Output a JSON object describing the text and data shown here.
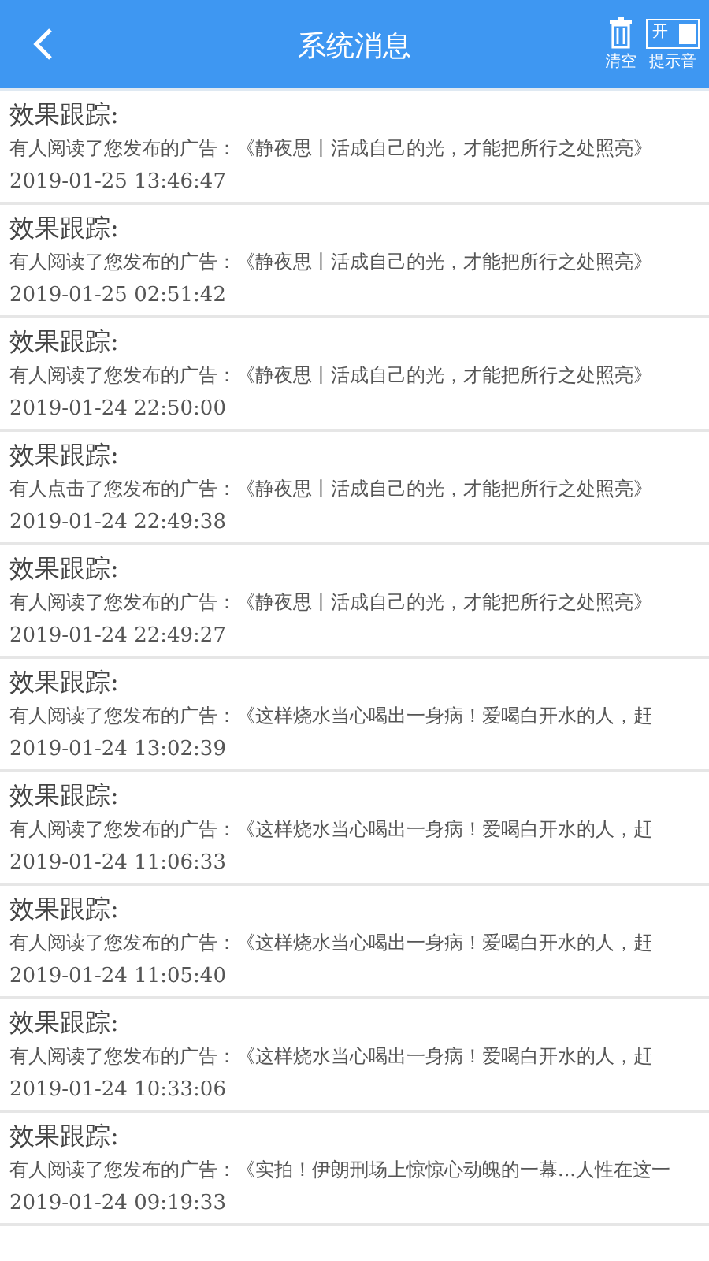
{
  "header": {
    "title": "系统消息",
    "clear_label": "清空",
    "sound_toggle": {
      "label": "开",
      "on": true
    },
    "sound_label": "提示音"
  },
  "messages": [
    {
      "title": "效果跟踪:",
      "text": "有人阅读了您发布的广告：《静夜思丨活成自己的光，才能把所行之处照亮》",
      "time": "2019-01-25 13:46:47"
    },
    {
      "title": "效果跟踪:",
      "text": "有人阅读了您发布的广告：《静夜思丨活成自己的光，才能把所行之处照亮》",
      "time": "2019-01-25 02:51:42"
    },
    {
      "title": "效果跟踪:",
      "text": "有人阅读了您发布的广告：《静夜思丨活成自己的光，才能把所行之处照亮》",
      "time": "2019-01-24 22:50:00"
    },
    {
      "title": "效果跟踪:",
      "text": "有人点击了您发布的广告：《静夜思丨活成自己的光，才能把所行之处照亮》",
      "time": "2019-01-24 22:49:38"
    },
    {
      "title": "效果跟踪:",
      "text": "有人阅读了您发布的广告：《静夜思丨活成自己的光，才能把所行之处照亮》",
      "time": "2019-01-24 22:49:27"
    },
    {
      "title": "效果跟踪:",
      "text": "有人阅读了您发布的广告：《这样烧水当心喝出一身病！爱喝白开水的人，赶",
      "time": "2019-01-24 13:02:39"
    },
    {
      "title": "效果跟踪:",
      "text": "有人阅读了您发布的广告：《这样烧水当心喝出一身病！爱喝白开水的人，赶",
      "time": "2019-01-24 11:06:33"
    },
    {
      "title": "效果跟踪:",
      "text": "有人阅读了您发布的广告：《这样烧水当心喝出一身病！爱喝白开水的人，赶",
      "time": "2019-01-24 11:05:40"
    },
    {
      "title": "效果跟踪:",
      "text": "有人阅读了您发布的广告：《这样烧水当心喝出一身病！爱喝白开水的人，赶",
      "time": "2019-01-24 10:33:06"
    },
    {
      "title": "效果跟踪:",
      "text": "有人阅读了您发布的广告：《实拍！伊朗刑场上惊惊心动魄的一幕...人性在这一",
      "time": "2019-01-24 09:19:33"
    }
  ]
}
